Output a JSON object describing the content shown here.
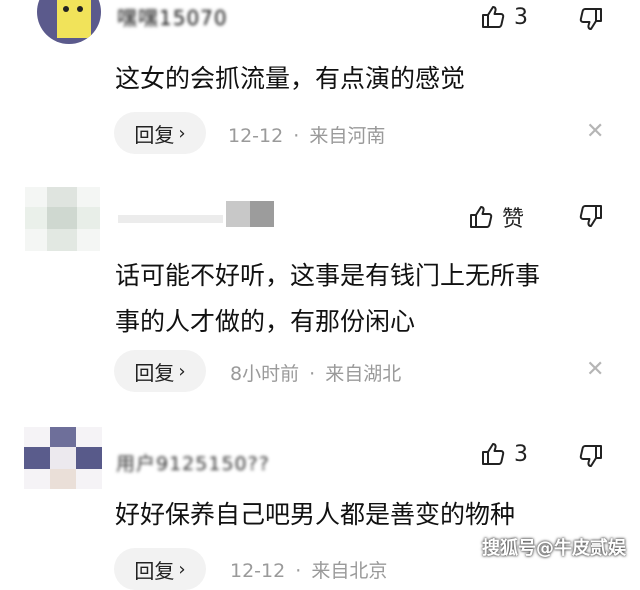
{
  "comments": [
    {
      "username": "嘿嘿15070",
      "likes": "3",
      "text_lines": [
        "这女的会抓流量，有点演的感觉"
      ],
      "reply_label": "回复",
      "time": "12-12",
      "location": "来自河南"
    },
    {
      "username": "",
      "likes": "赞",
      "text_lines": [
        "话可能不好听，这事是有钱门上无所事",
        "事的人才做的，有那份闲心"
      ],
      "reply_label": "回复",
      "time": "8小时前",
      "location": "来自湖北"
    },
    {
      "username": "用户9125150??",
      "likes": "3",
      "text_lines": [
        "好好保养自己吧男人都是善变的物种"
      ],
      "reply_label": "回复",
      "time": "12-12",
      "location": "来自北京"
    }
  ],
  "separator": "·",
  "watermark": "搜狐号@牛皮贰娱",
  "icons": {
    "like": "thumbs-up-icon",
    "dislike": "thumbs-down-icon",
    "close": "close-icon",
    "reply_arrow": "chevron-right-icon"
  },
  "colors": {
    "meta_gray": "#9a9a9a",
    "pill_bg": "#f2f2f2",
    "avatar1_bg": "#5b5a8c",
    "avatar1_fg": "#f1e35a"
  }
}
